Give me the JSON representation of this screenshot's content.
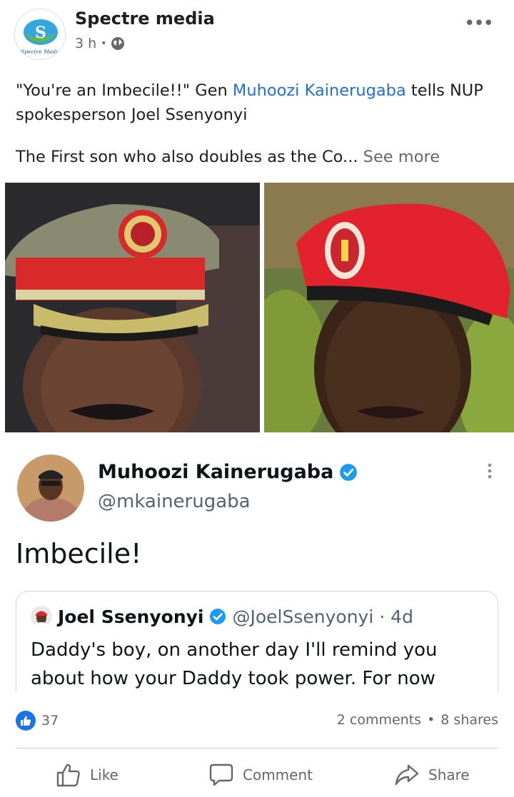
{
  "post": {
    "page_name": "Spectre media",
    "time": "3 h",
    "visibility_icon": "globe-icon",
    "caption_quote": "\"You're an Imbecile!!\" Gen ",
    "caption_mention": "Muhoozi Kainerugaba",
    "caption_rest": " tells NUP spokesperson Joel Ssenyonyi",
    "caption_second": "The First son who also doubles as the Co...",
    "see_more": "See more",
    "logo_text": "Spectre Media"
  },
  "tweet": {
    "name": "Muhoozi Kainerugaba",
    "handle": "@mkainerugaba",
    "text": "Imbecile!",
    "quote": {
      "name": "Joel Ssenyonyi",
      "handle": "@JoelSsenyonyi",
      "time": "· 4d",
      "text": "Daddy's boy, on another day I'll remind you about how your Daddy took power. For now"
    }
  },
  "engagement": {
    "reactions": "37",
    "comments": "2 comments",
    "shares": "8 shares"
  },
  "actions": {
    "like": "Like",
    "comment": "Comment",
    "share": "Share"
  },
  "colors": {
    "accent": "#1b74e4",
    "mention": "#216fdb",
    "verified": "#1d9bf0",
    "muted": "#65676b"
  }
}
